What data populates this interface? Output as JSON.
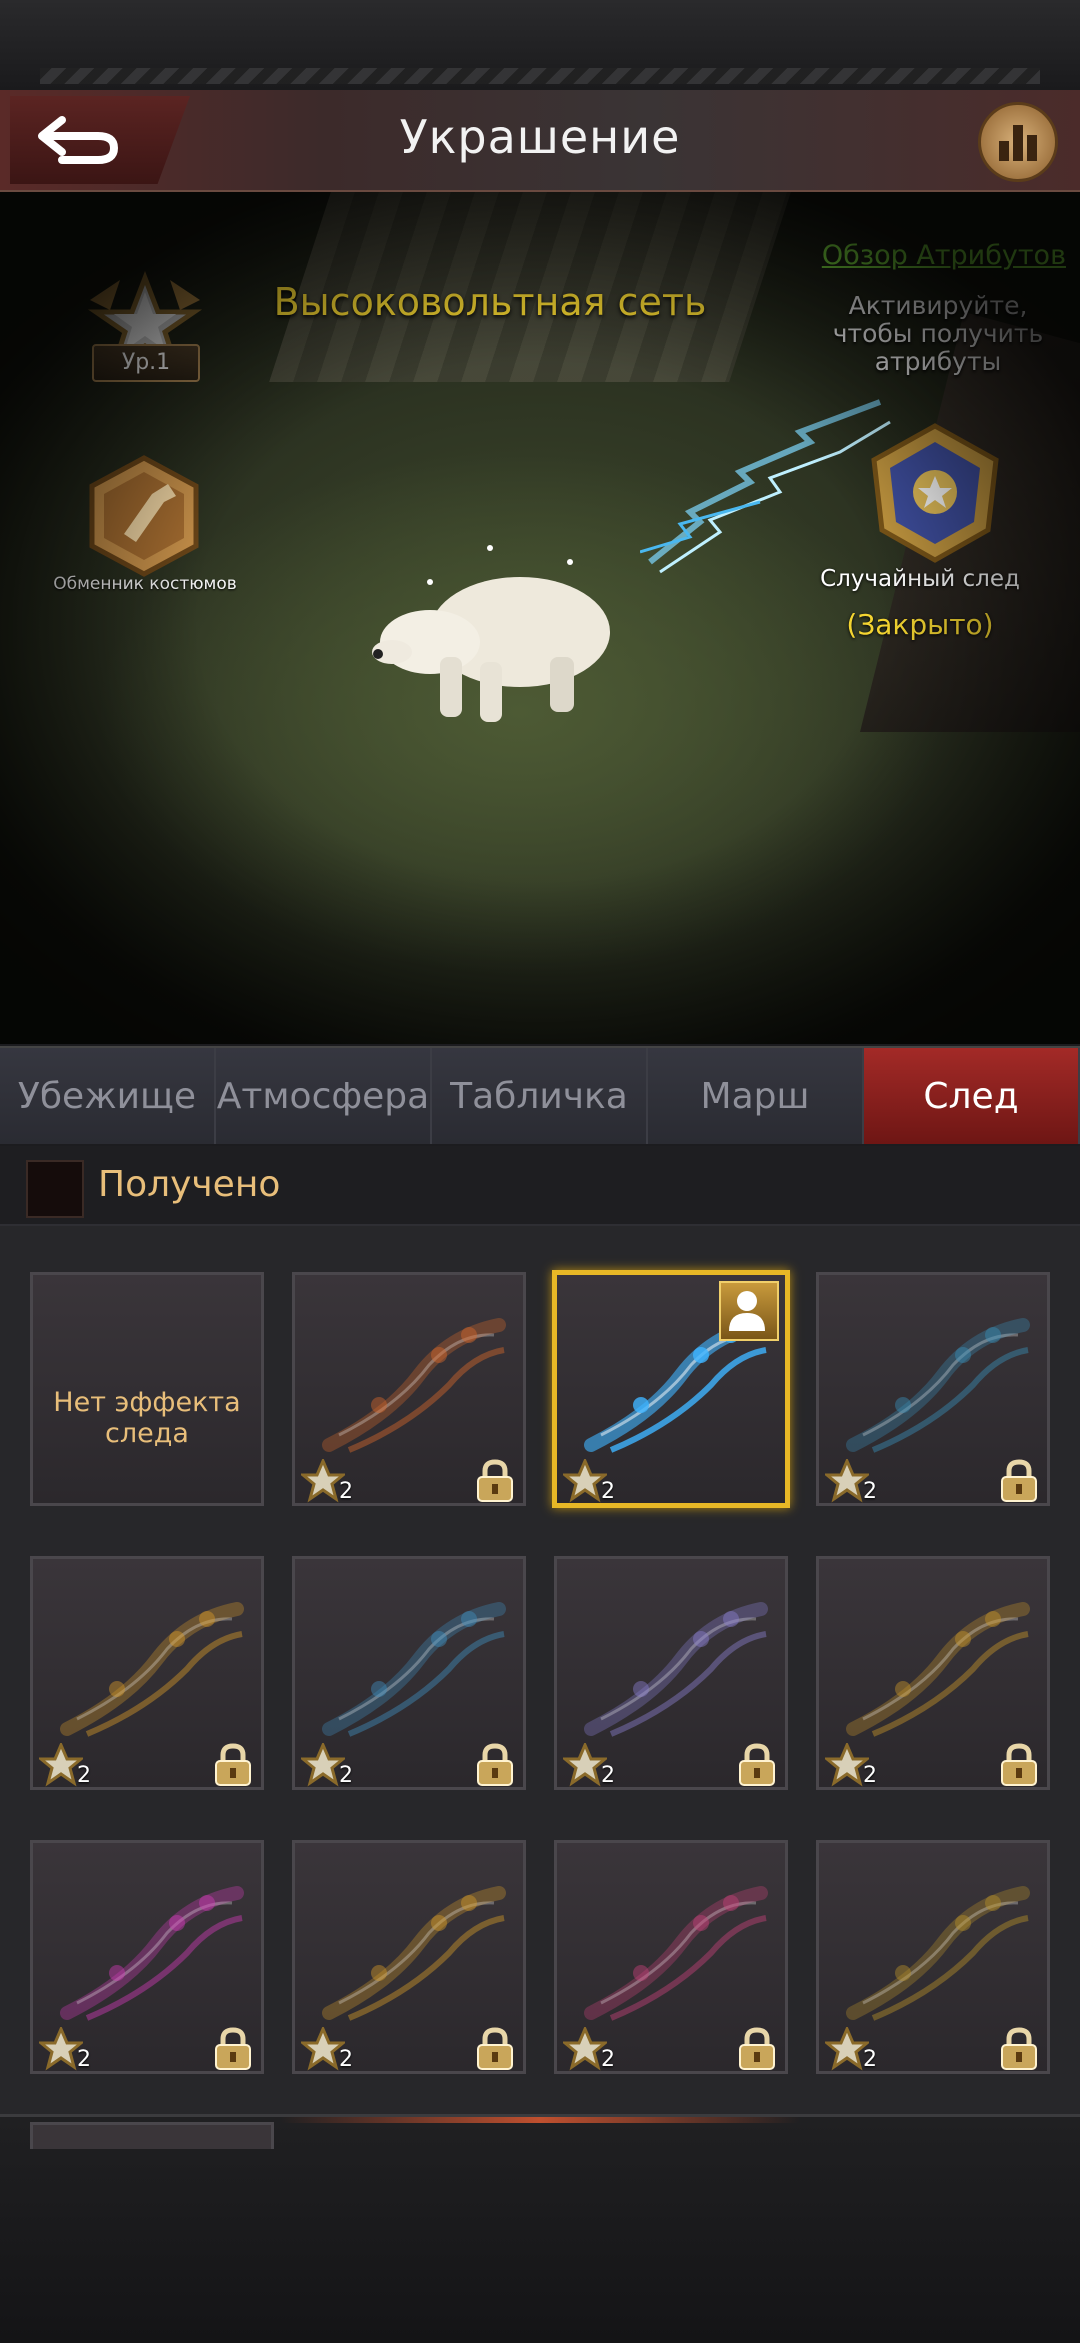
{
  "header": {
    "title": "Украшение"
  },
  "scene": {
    "effect_name": "Высоковольтная сеть",
    "attributes_link": "Обзор Атрибутов",
    "attributes_hint": "Активируйте, чтобы получить атрибуты",
    "level_label": "Ур.1",
    "exchange_label": "Обменник костюмов",
    "random_trail_label": "Случайный след",
    "random_trail_status": "(Закрыто)"
  },
  "tabs": [
    {
      "label": "Убежище",
      "active": false
    },
    {
      "label": "Атмосфера",
      "active": false
    },
    {
      "label": "Табличка",
      "active": false
    },
    {
      "label": "Марш",
      "active": false
    },
    {
      "label": "След",
      "active": true
    }
  ],
  "section": {
    "title": "Получено"
  },
  "tiles": [
    {
      "empty_label": "Нет эффекта следа",
      "tier": "",
      "locked": false,
      "selected": false,
      "trail": "none"
    },
    {
      "tier": "2",
      "locked": true,
      "selected": false,
      "trail": "pumpkin-trail",
      "color": "#d8692b"
    },
    {
      "tier": "2",
      "locked": false,
      "selected": true,
      "trail": "lightning-trail",
      "color": "#3fb4ff"
    },
    {
      "tier": "2",
      "locked": true,
      "selected": false,
      "trail": "snowflake-trail",
      "color": "#3a8fb8"
    },
    {
      "tier": "2",
      "locked": true,
      "selected": false,
      "trail": "easter-egg-trail",
      "color": "#d89a2a"
    },
    {
      "tier": "2",
      "locked": true,
      "selected": false,
      "trail": "feather-trail",
      "color": "#3f8fc0"
    },
    {
      "tier": "2",
      "locked": true,
      "selected": false,
      "trail": "dragonfly-trail",
      "color": "#8a7fd0"
    },
    {
      "tier": "2",
      "locked": true,
      "selected": false,
      "trail": "music-note-trail",
      "color": "#c9962a"
    },
    {
      "tier": "2",
      "locked": true,
      "selected": false,
      "trail": "heart-trail",
      "color": "#d23cb8"
    },
    {
      "tier": "2",
      "locked": true,
      "selected": false,
      "trail": "lotus-trail",
      "color": "#d49a2a"
    },
    {
      "tier": "2",
      "locked": true,
      "selected": false,
      "trail": "sakura-trail",
      "color": "#c8427a"
    },
    {
      "tier": "2",
      "locked": true,
      "selected": false,
      "trail": "sparkle-trail",
      "color": "#b8922a"
    }
  ]
}
